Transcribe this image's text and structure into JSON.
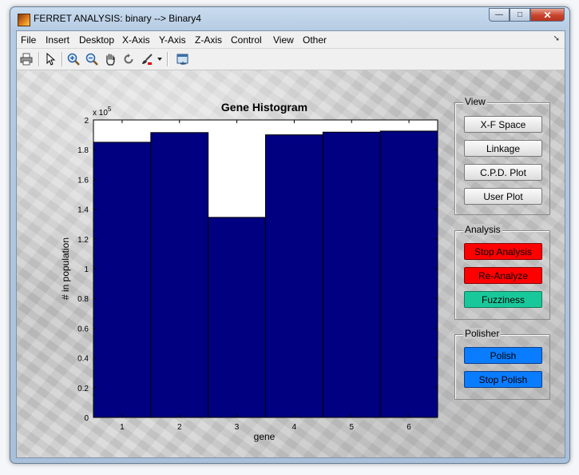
{
  "window": {
    "title": "FERRET ANALYSIS: binary --> Binary4",
    "controls": {
      "minimize": "—",
      "maximize": "□",
      "close": "✕"
    }
  },
  "menubar": {
    "items": [
      "File",
      "Insert",
      "Desktop",
      "X-Axis",
      "Y-Axis",
      "Z-Axis",
      "Control",
      "View",
      "Other"
    ],
    "overflow_arrow": "➘"
  },
  "toolbar": {
    "buttons": [
      "print-icon",
      "pointer-icon",
      "zoom-in-icon",
      "zoom-out-icon",
      "pan-icon",
      "rotate-icon",
      "data-brush-icon",
      "dropdown-arrow-icon",
      "dock-icon"
    ]
  },
  "view_panel": {
    "title": "View",
    "buttons": [
      "X-F Space",
      "Linkage",
      "C.P.D. Plot",
      "User Plot"
    ]
  },
  "analysis_panel": {
    "title": "Analysis",
    "buttons": [
      {
        "label": "Stop Analysis",
        "color": "#ff0000"
      },
      {
        "label": "Re-Analyze",
        "color": "#ff0000"
      },
      {
        "label": "Fuzziness",
        "color": "#19c89a"
      }
    ]
  },
  "polisher_panel": {
    "title": "Polisher",
    "buttons": [
      {
        "label": "Polish",
        "color": "#0a7cff"
      },
      {
        "label": "Stop Polish",
        "color": "#0a7cff"
      }
    ]
  },
  "chart_data": {
    "type": "bar",
    "title": "Gene Histogram",
    "xlabel": "gene",
    "ylabel": "# in population",
    "y_multiplier": "x 10",
    "y_multiplier_exponent": "5",
    "categories": [
      "1",
      "2",
      "3",
      "4",
      "5",
      "6"
    ],
    "values": [
      185000,
      191500,
      134500,
      190000,
      191800,
      192500
    ],
    "ylim": [
      0,
      200000
    ],
    "xlim": [
      0.5,
      6.5
    ],
    "yticks": [
      0,
      20000,
      40000,
      60000,
      80000,
      100000,
      120000,
      140000,
      160000,
      180000,
      200000
    ],
    "ytick_labels": [
      "0",
      "0.2",
      "0.4",
      "0.6",
      "0.8",
      "1",
      "1.2",
      "1.4",
      "1.6",
      "1.8",
      "2"
    ],
    "bar_color": "#000080",
    "grid": false
  }
}
